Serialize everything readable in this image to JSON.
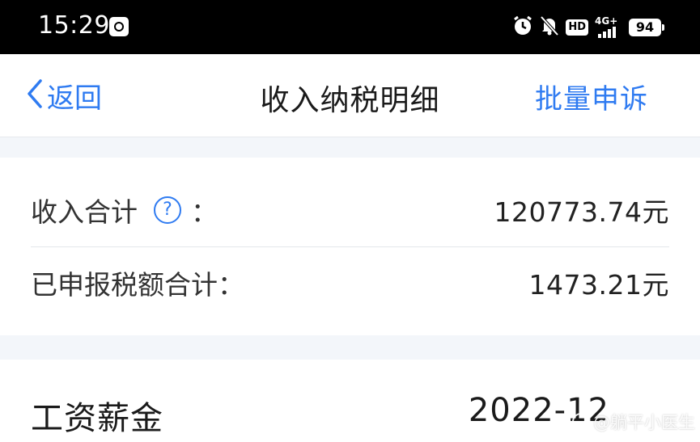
{
  "status_bar": {
    "time": "15:29",
    "icons": [
      "screenshot-app-icon",
      "alarm-icon",
      "mute-icon",
      "hd-icon",
      "network-4g-icon",
      "battery-icon"
    ],
    "hd_label": "HD",
    "network_label": "4G+",
    "battery_level": "94"
  },
  "nav": {
    "back_label": "返回",
    "title": "收入纳税明细",
    "action_label": "批量申诉"
  },
  "summary": {
    "income_label": "收入合计",
    "help_symbol": "?",
    "colon": "：",
    "income_value": "120773.74元",
    "tax_label": "已申报税额合计：",
    "tax_value": "1473.21元"
  },
  "items": [
    {
      "category": "工资薪金",
      "period": "2022-12"
    }
  ],
  "watermark": "@躺平小医生",
  "colors": {
    "accent": "#2f7bf1",
    "background": "#f3f6fa",
    "status_bar": "#000000"
  }
}
